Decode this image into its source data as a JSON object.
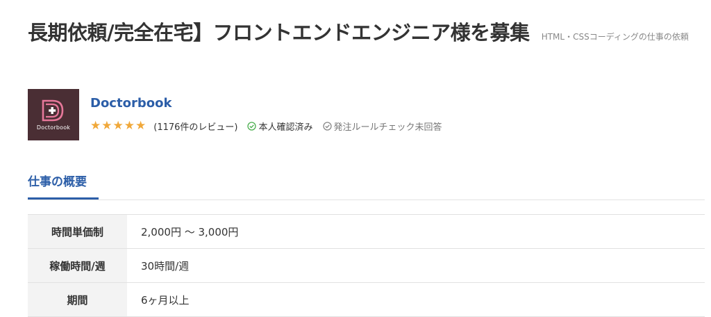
{
  "job": {
    "title": "長期依頼/完全在宅】フロントエンドエンジニア様を募集",
    "category": "HTML・CSSコーディングの仕事の依頼"
  },
  "client": {
    "logo_text": "Doctorbook",
    "name": "Doctorbook",
    "rating_stars": 5,
    "review_count_text": "(1176件のレビュー)",
    "verified_label": "本人確認済み",
    "rule_check_label": "発注ルールチェック未回答"
  },
  "tabs": [
    {
      "label": "仕事の概要",
      "active": true
    }
  ],
  "summary_table": [
    {
      "label": "時間単価制",
      "value": "2,000円 〜 3,000円"
    },
    {
      "label": "稼働時間/週",
      "value": "30時間/週"
    },
    {
      "label": "期間",
      "value": "6ヶ月以上"
    }
  ],
  "colors": {
    "accent": "#2c5ea8",
    "star": "#f0a83a",
    "logo_bg": "#4a2e34",
    "logo_mark": "#e7789a",
    "verified_icon": "#4caf50",
    "table_header_bg": "#f3f3f3"
  },
  "icons": {
    "verified": "check-circle-icon",
    "rule_check": "check-circle-outline-icon",
    "star": "star-icon"
  }
}
